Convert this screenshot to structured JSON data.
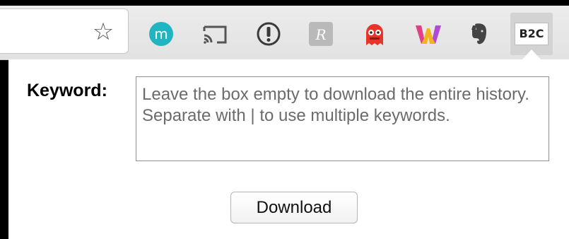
{
  "toolbar": {
    "bookmark_icon": "star-icon",
    "extensions": [
      {
        "name": "m",
        "icon": "m-circle-icon",
        "color": "#21b5c2"
      },
      {
        "name": "cast",
        "icon": "cast-icon",
        "color": "#555555"
      },
      {
        "name": "info",
        "icon": "exclamation-circle-icon",
        "color": "#3a3a3a"
      },
      {
        "name": "R",
        "icon": "r-square-icon",
        "color": "#b9b9b9"
      },
      {
        "name": "vpn",
        "icon": "red-monster-icon",
        "color": "#e8352b"
      },
      {
        "name": "W",
        "icon": "w-logo-icon",
        "color": "#f3b41b"
      },
      {
        "name": "evernote",
        "icon": "elephant-icon",
        "color": "#444444"
      }
    ],
    "active_extension_label": "B2C"
  },
  "popup": {
    "keyword_label": "Keyword:",
    "keyword_placeholder": "Leave the box empty to download the entire history. Separate with | to use multiple keywords.",
    "keyword_value": "",
    "download_label": "Download"
  }
}
